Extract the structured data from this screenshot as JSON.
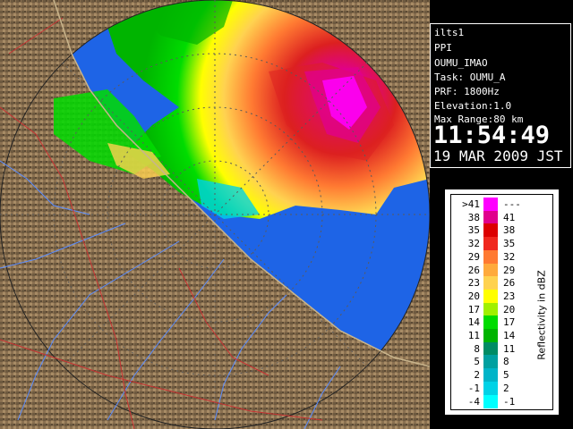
{
  "radar": {
    "station": "ilts1",
    "scan_mode": "PPI",
    "site": "OUMU_IMAO",
    "task": "Task: OUMU_A",
    "prf": "PRF: 1800Hz",
    "elevation": "Elevation:1.0",
    "max_range": "Max Range:80 km",
    "time": "11:54:49",
    "date": "19 MAR 2009 JST"
  },
  "legend": {
    "title": "Reflectivity in dBZ",
    "rows": [
      {
        "lo": ">41",
        "hi": "---",
        "color": "#ff00ff"
      },
      {
        "lo": "38",
        "hi": "41",
        "color": "#e0008c"
      },
      {
        "lo": "35",
        "hi": "38",
        "color": "#dc0000"
      },
      {
        "lo": "32",
        "hi": "35",
        "color": "#f0281e"
      },
      {
        "lo": "29",
        "hi": "32",
        "color": "#ff7a32"
      },
      {
        "lo": "26",
        "hi": "29",
        "color": "#ffaa3c"
      },
      {
        "lo": "23",
        "hi": "26",
        "color": "#ffd250"
      },
      {
        "lo": "20",
        "hi": "23",
        "color": "#ffff00"
      },
      {
        "lo": "17",
        "hi": "20",
        "color": "#a0f000"
      },
      {
        "lo": "14",
        "hi": "17",
        "color": "#00dc00"
      },
      {
        "lo": "11",
        "hi": "14",
        "color": "#00b400"
      },
      {
        "lo": "8",
        "hi": "11",
        "color": "#008c64"
      },
      {
        "lo": "5",
        "hi": "8",
        "color": "#00a0a0"
      },
      {
        "lo": "2",
        "hi": "5",
        "color": "#00b4c8"
      },
      {
        "lo": "-1",
        "hi": "2",
        "color": "#00d2e6"
      },
      {
        "lo": "-4",
        "hi": "-1",
        "color": "#00ffff"
      }
    ]
  },
  "colors": {
    "sea": "#1e64e6",
    "land": "#8c7354",
    "range_ring": "#5a5a5a",
    "river": "#5a8cff",
    "border": "#c83232"
  }
}
